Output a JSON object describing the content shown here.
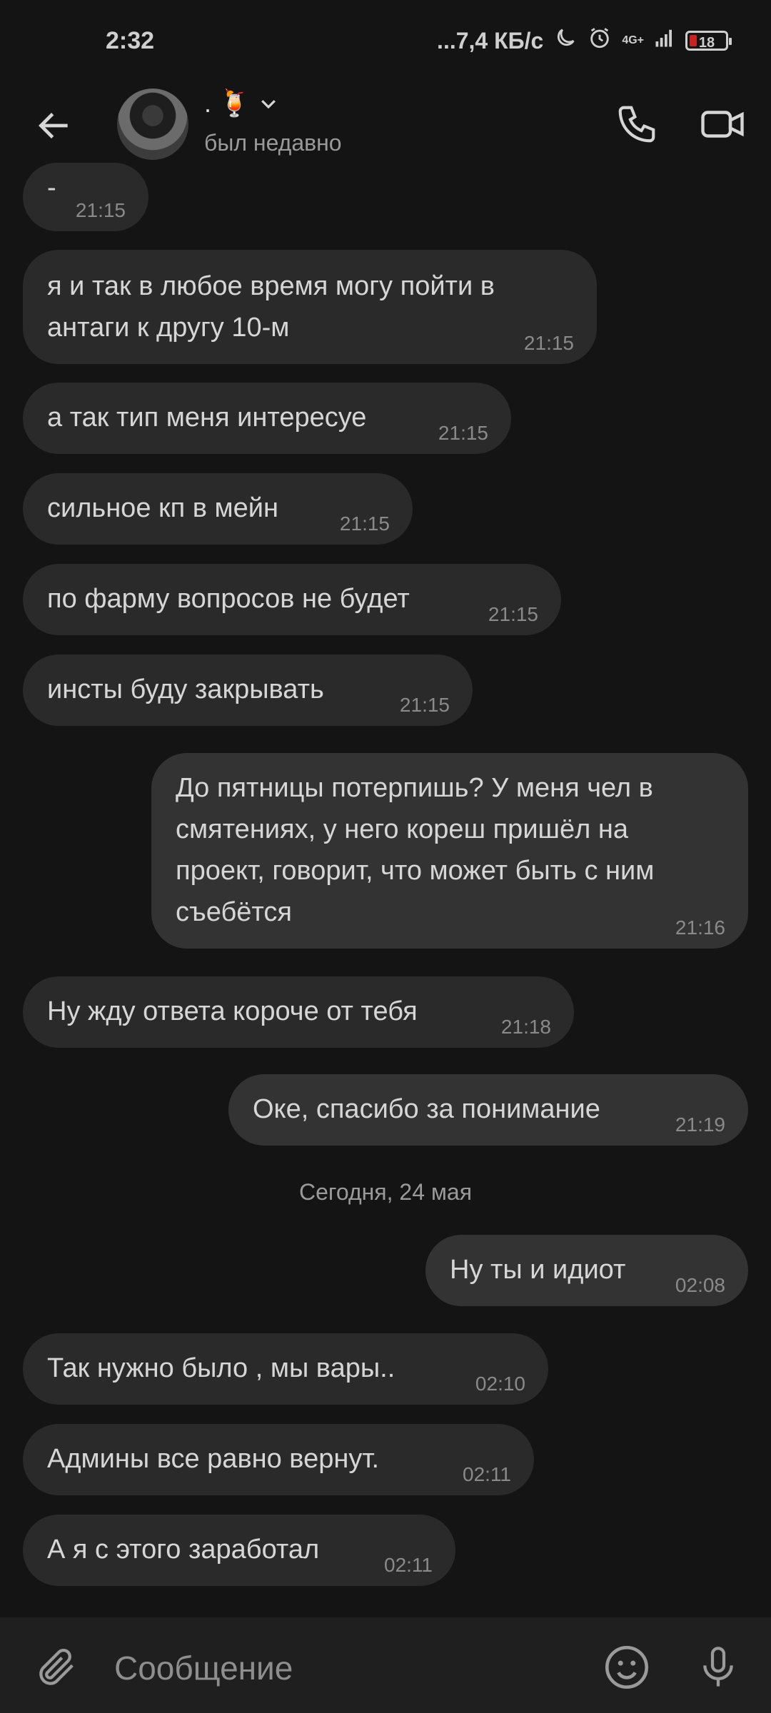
{
  "status_bar": {
    "time": "2:32",
    "network_speed": "...7,4 КБ/с",
    "network_type": "4G+",
    "battery": "18"
  },
  "header": {
    "contact_name": ".",
    "contact_emoji": "🍹",
    "status": "был недавно",
    "icons": [
      "back-arrow-icon",
      "chevron-down-icon",
      "phone-icon",
      "video-camera-icon"
    ]
  },
  "messages": [
    {
      "dir": "in",
      "text": "-",
      "time": "21:15"
    },
    {
      "dir": "in",
      "text": "я и так в любое время могу пойти в антаги к другу 10-м",
      "time": "21:15"
    },
    {
      "dir": "in",
      "text": "а так тип меня интересуе",
      "time": "21:15"
    },
    {
      "dir": "in",
      "text": "сильное кп в мейн",
      "time": "21:15"
    },
    {
      "dir": "in",
      "text": "по фарму вопросов не будет",
      "time": "21:15"
    },
    {
      "dir": "in",
      "text": "инсты буду закрывать",
      "time": "21:15"
    },
    {
      "dir": "out",
      "text": "До пятницы потерпишь? У меня чел в смятениях, у него кореш пришёл на проект, говорит, что может быть с ним съебётся",
      "time": "21:16"
    },
    {
      "dir": "in",
      "text": "Ну жду ответа короче от тебя",
      "time": "21:18"
    },
    {
      "dir": "out",
      "text": "Оке, спасибо за понимание",
      "time": "21:19"
    },
    {
      "dir": "out",
      "text": "Ну ты и идиот",
      "time": "02:08"
    },
    {
      "dir": "in",
      "text": "Так нужно было , мы вары..",
      "time": "02:10"
    },
    {
      "dir": "in",
      "text": "Админы все равно вернут.",
      "time": "02:11"
    },
    {
      "dir": "in",
      "text": "А я с этого заработал",
      "time": "02:11"
    }
  ],
  "date_separator": "Сегодня, 24 мая",
  "input_bar": {
    "placeholder": "Сообщение",
    "icons": [
      "paperclip-icon",
      "emoji-icon",
      "microphone-icon"
    ]
  },
  "colors": {
    "background": "#141414",
    "bubble_in": "#2a2a2a",
    "bubble_out": "#333333",
    "text": "#d6d6d6",
    "timestamp": "#8a8a8a",
    "battery_low": "#c82222"
  }
}
